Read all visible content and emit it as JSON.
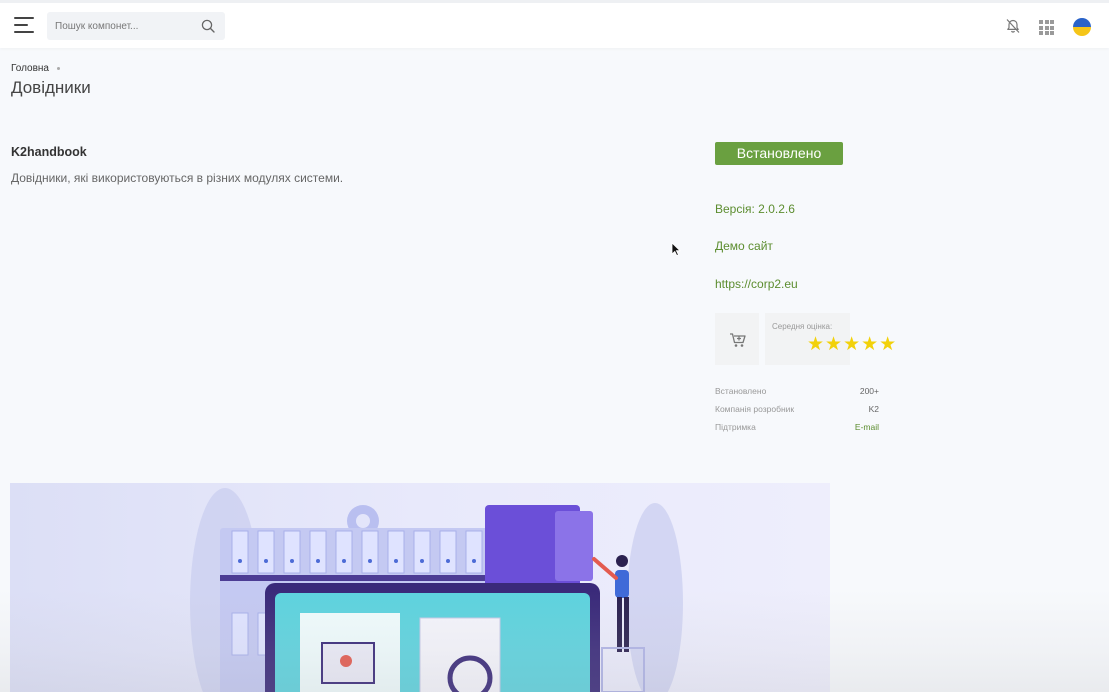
{
  "header": {
    "search_placeholder": "Пошук компонет..."
  },
  "breadcrumb": {
    "home": "Головна"
  },
  "page_title": "Довідники",
  "component": {
    "name": "K2handbook",
    "description": "Довідники, які використовуються в різних модулях системи."
  },
  "sidebar": {
    "installed_button": "Встановлено",
    "version": "Версія: 2.0.2.6",
    "demo_link": "Демо сайт",
    "url": "https://corp2.eu",
    "rating_label": "Середня оцінка:",
    "rating": 5,
    "rating_max": 5,
    "stars": "★★★★★",
    "info": [
      {
        "label": "Встановлено",
        "value": "200+"
      },
      {
        "label": "Компанія розробник",
        "value": "K2"
      },
      {
        "label": "Підтримка",
        "value": "E-mail"
      }
    ]
  },
  "colors": {
    "accent_green": "#6aa040",
    "link_green": "#5c8d2f",
    "star_yellow": "#f2d10a",
    "flag_blue": "#2a63c9",
    "flag_yellow": "#f5c518"
  },
  "icons": [
    "menu-icon",
    "search-icon",
    "notification-off-icon",
    "apps-grid-icon",
    "ukraine-flag-icon",
    "cart-icon"
  ]
}
